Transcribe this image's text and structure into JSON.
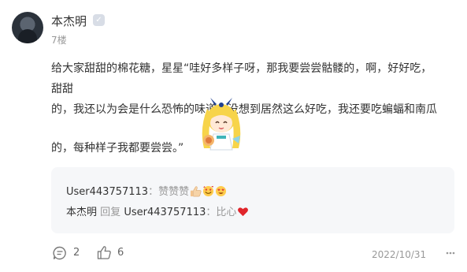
{
  "comment": {
    "username": "本杰明",
    "badge": "✓",
    "floor": "7楼",
    "text_line1": "给大家甜甜的棉花糖，星星“哇好多样子呀，那我要尝尝骷髅的，啊，好好吃，甜甜",
    "text_line2": "的，我还以为会是什么恐怖的味道，没想到居然这么好吃，我还要吃蝙蝠和南瓜",
    "text_line3": "的，每种样子我都要尝尝。”",
    "sticker_icon": "anime-girl-sticker"
  },
  "replies": [
    {
      "user": "User443757113",
      "separator": "：",
      "text": "赞赞赞",
      "emojis": [
        "thumbs-up-emoji",
        "smiling-hearts-emoji",
        "heart-eyes-emoji"
      ]
    },
    {
      "user": "本杰明",
      "reply_word": "回复",
      "target": "User443757113",
      "separator": "：",
      "text": "比心",
      "emojis": [
        "red-heart-emoji"
      ]
    }
  ],
  "actions": {
    "comment_count": "2",
    "like_count": "6",
    "date": "2022/10/31",
    "more_icon": "more-icon"
  },
  "colors": {
    "text": "#333333",
    "muted": "#999999",
    "reply_bg": "#f6f7f9"
  }
}
